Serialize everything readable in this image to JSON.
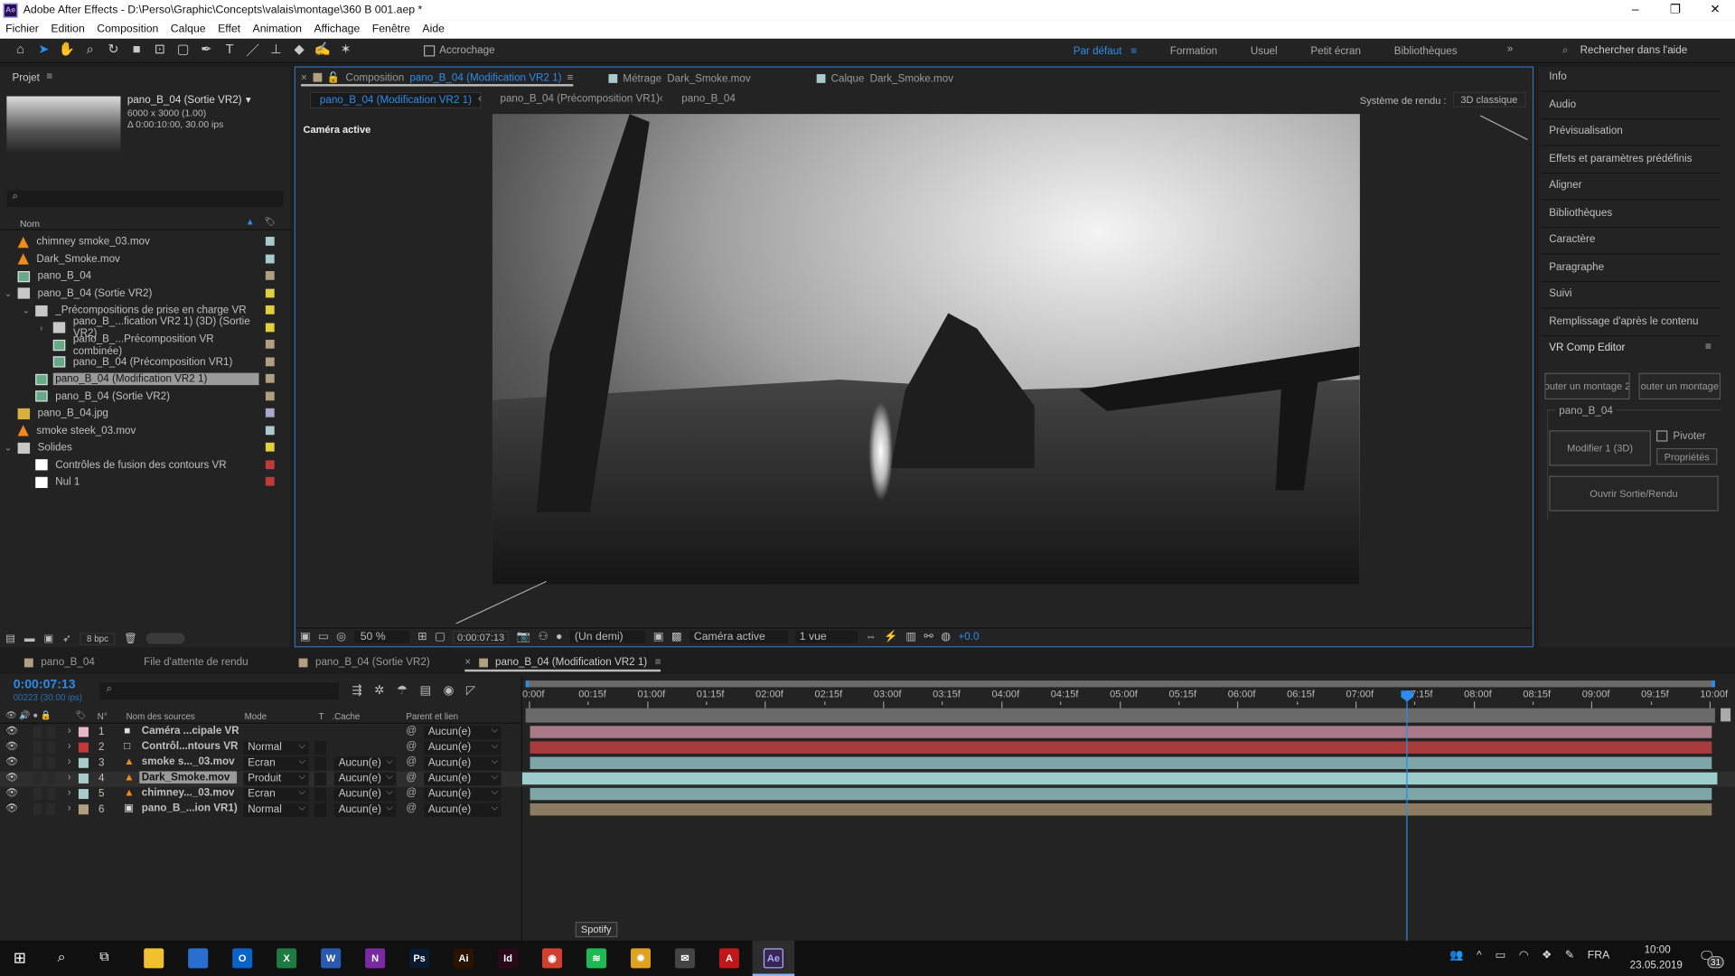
{
  "window": {
    "title": "Adobe After Effects - D:\\Perso\\Graphic\\Concepts\\valais\\montage\\360 B 001.aep *",
    "app_badge": "Ae"
  },
  "menu": [
    "Fichier",
    "Edition",
    "Composition",
    "Calque",
    "Effet",
    "Animation",
    "Affichage",
    "Fenêtre",
    "Aide"
  ],
  "toolbar": {
    "tools": [
      "home-icon",
      "selection-icon",
      "hand-icon",
      "zoom-icon",
      "rotate-icon",
      "camera-icon",
      "pan-behind-icon",
      "rectangle-icon",
      "pen-icon",
      "text-icon",
      "brush-icon",
      "clone-stamp-icon",
      "eraser-icon",
      "roto-brush-icon",
      "puppet-icon"
    ],
    "snapping_label": "Accrochage",
    "workspaces": [
      "Par défaut",
      "Formation",
      "Usuel",
      "Petit écran",
      "Bibliothèques"
    ],
    "active_workspace": "Par défaut",
    "search_placeholder": "Rechercher dans l'aide"
  },
  "project": {
    "title": "Projet",
    "selected_name": "pano_B_04 (Sortie VR2)",
    "selected_size": "6000 x 3000 (1.00)",
    "selected_duration": "Δ 0:00:10:00, 30.00 ips",
    "col_name": "Nom",
    "bpc": "8 bpc",
    "items": [
      {
        "name": "chimney smoke_03.mov",
        "icon": "footage",
        "depth": 0,
        "color": "#a8cccc"
      },
      {
        "name": "Dark_Smoke.mov",
        "icon": "footage",
        "depth": 0,
        "color": "#a8cccc"
      },
      {
        "name": "pano_B_04",
        "icon": "composition",
        "depth": 0,
        "color": "#b0a080"
      },
      {
        "name": "pano_B_04 (Sortie VR2)",
        "icon": "folder",
        "depth": 0,
        "expanded": true,
        "color": "#e0d040"
      },
      {
        "name": "_Précompositions de prise en charge VR",
        "icon": "folder",
        "depth": 1,
        "expanded": true,
        "color": "#e0d040"
      },
      {
        "name": "pano_B_...fication VR2 1) (3D) (Sortie VR2)",
        "icon": "folder",
        "depth": 2,
        "expanded": false,
        "color": "#e0d040"
      },
      {
        "name": "pano_B_...Précomposition VR combinée)",
        "icon": "composition",
        "depth": 2,
        "color": "#b0a080"
      },
      {
        "name": "pano_B_04 (Précomposition VR1)",
        "icon": "composition",
        "depth": 2,
        "color": "#b0a080"
      },
      {
        "name": "pano_B_04 (Modification VR2 1)",
        "icon": "composition",
        "depth": 1,
        "color": "#b0a080",
        "selected": true
      },
      {
        "name": "pano_B_04 (Sortie VR2)",
        "icon": "composition",
        "depth": 1,
        "color": "#b0a080"
      },
      {
        "name": "pano_B_04.jpg",
        "icon": "image",
        "depth": 0,
        "color": "#a8a8cc"
      },
      {
        "name": "smoke steek_03.mov",
        "icon": "footage",
        "depth": 0,
        "color": "#a8cccc"
      },
      {
        "name": "Solides",
        "icon": "folder",
        "depth": 0,
        "expanded": true,
        "color": "#e0d040"
      },
      {
        "name": "Contrôles de fusion des contours VR",
        "icon": "solid",
        "depth": 1,
        "color": "#c03a3a"
      },
      {
        "name": "Nul 1",
        "icon": "solid",
        "depth": 1,
        "color": "#c03a3a"
      }
    ]
  },
  "viewer": {
    "tabs": [
      {
        "kind": "Composition",
        "name": "pano_B_04 (Modification VR2 1)",
        "active": true
      },
      {
        "kind": "Métrage",
        "name": "Dark_Smoke.mov"
      },
      {
        "kind": "Calque",
        "name": "Dark_Smoke.mov"
      }
    ],
    "breadcrumbs": [
      "pano_B_04 (Modification VR2 1)",
      "pano_B_04 (Précomposition VR1)",
      "pano_B_04"
    ],
    "renderer_label": "Système de rendu :",
    "renderer_value": "3D classique",
    "camera_label": "Caméra active",
    "zoom": "50 %",
    "timecode": "0:00:07:13",
    "resolution": "(Un demi)",
    "camera_select": "Caméra active",
    "views": "1 vue",
    "exposure": "+0.0"
  },
  "right_panel": {
    "items": [
      "Info",
      "Audio",
      "Prévisualisation",
      "Effets et paramètres prédéfinis",
      "Aligner",
      "Bibliothèques",
      "Caractère",
      "Paragraphe",
      "Suivi",
      "Remplissage d'après le contenu"
    ],
    "vr_title": "VR Comp Editor",
    "btn_add1": "outer un montage 2",
    "btn_add2": "outer un montage",
    "group": "pano_B_04",
    "btn_modify": "Modifier 1 (3D)",
    "pivot_label": "Pivoter",
    "pivot_checked": false,
    "btn_props": "Propriétés",
    "btn_output": "Ouvrir Sortie/Rendu"
  },
  "timeline": {
    "tabs": [
      {
        "name": "pano_B_04"
      },
      {
        "name": "File d'attente de rendu"
      },
      {
        "name": "pano_B_04 (Sortie VR2)"
      },
      {
        "name": "pano_B_04 (Modification VR2 1)",
        "active": true
      }
    ],
    "timecode": "0:00:07:13",
    "frame_info": "00223 (30.00 ips)",
    "cols": {
      "num": "N°",
      "source": "Nom des sources",
      "mode": "Mode",
      "t": "T",
      "matte": ".Cache",
      "parent": "Parent et lien"
    },
    "ruler": [
      "0:00f",
      "00:15f",
      "01:00f",
      "01:15f",
      "02:00f",
      "02:15f",
      "03:00f",
      "03:15f",
      "04:00f",
      "04:15f",
      "05:00f",
      "05:15f",
      "06:00f",
      "06:15f",
      "07:00f",
      "07:15f",
      "08:00f",
      "08:15f",
      "09:00f",
      "09:15f",
      "10:00f"
    ],
    "duration_seconds": 10,
    "playhead_seconds": 7.433,
    "layers": [
      {
        "num": "1",
        "name": "Caméra ...cipale VR",
        "icon": "camera",
        "label": "#e6b8c8",
        "mode": "",
        "matte": "",
        "parent": "Aucun(e)",
        "bar": "#a87a88"
      },
      {
        "num": "2",
        "name": "Contrôl...ntours VR",
        "icon": "solid",
        "label": "#c03a3a",
        "mode": "Normal",
        "matte": "",
        "parent": "Aucun(e)",
        "bar": "#a83c3c"
      },
      {
        "num": "3",
        "name": "smoke s..._03.mov",
        "icon": "footage",
        "label": "#a8cccc",
        "mode": "Ecran",
        "matte": "Aucun(e)",
        "parent": "Aucun(e)",
        "bar": "#7fa6a6"
      },
      {
        "num": "4",
        "name": "Dark_Smoke.mov",
        "icon": "footage",
        "label": "#a8cccc",
        "mode": "Produit",
        "matte": "Aucun(e)",
        "parent": "Aucun(e)",
        "bar": "#9ccccc",
        "selected": true
      },
      {
        "num": "5",
        "name": "chimney..._03.mov",
        "icon": "footage",
        "label": "#a8cccc",
        "mode": "Ecran",
        "matte": "Aucun(e)",
        "parent": "Aucun(e)",
        "bar": "#7fa6a6"
      },
      {
        "num": "6",
        "name": "pano_B_...ion VR1)",
        "icon": "composition",
        "label": "#b0a080",
        "mode": "Normal",
        "matte": "Aucun(e)",
        "parent": "Aucun(e)",
        "bar": "#8c7c62"
      }
    ]
  },
  "taskbar": {
    "tooltip": "Spotify",
    "apps": [
      {
        "n": "file-explorer",
        "c": "#f0c030",
        "t": ""
      },
      {
        "n": "app-blue",
        "c": "#2a6fd0",
        "t": ""
      },
      {
        "n": "outlook",
        "c": "#0a64c8",
        "t": "O"
      },
      {
        "n": "excel",
        "c": "#1e7a40",
        "t": "X"
      },
      {
        "n": "word",
        "c": "#2a5ab0",
        "t": "W"
      },
      {
        "n": "onenote",
        "c": "#7a2aa0",
        "t": "N"
      },
      {
        "n": "photoshop",
        "c": "#0a1a30",
        "t": "Ps"
      },
      {
        "n": "illustrator",
        "c": "#2a1400",
        "t": "Ai"
      },
      {
        "n": "indesign",
        "c": "#2a0a18",
        "t": "Id"
      },
      {
        "n": "chrome",
        "c": "#d04030",
        "t": "◉"
      },
      {
        "n": "spotify",
        "c": "#1db954",
        "t": "≋"
      },
      {
        "n": "app-sun",
        "c": "#e0a020",
        "t": "✹"
      },
      {
        "n": "mail",
        "c": "#444",
        "t": "✉"
      },
      {
        "n": "acrobat",
        "c": "#c01818",
        "t": "A"
      },
      {
        "n": "after-effects",
        "c": "#1a0a3a",
        "t": "Ae"
      }
    ],
    "language": "FRA",
    "time": "10:00",
    "date": "23.05.2019",
    "notifications": "31"
  },
  "colors": {
    "accent": "#2d8ceb",
    "panel": "#232323",
    "background": "#1d1d1d"
  }
}
